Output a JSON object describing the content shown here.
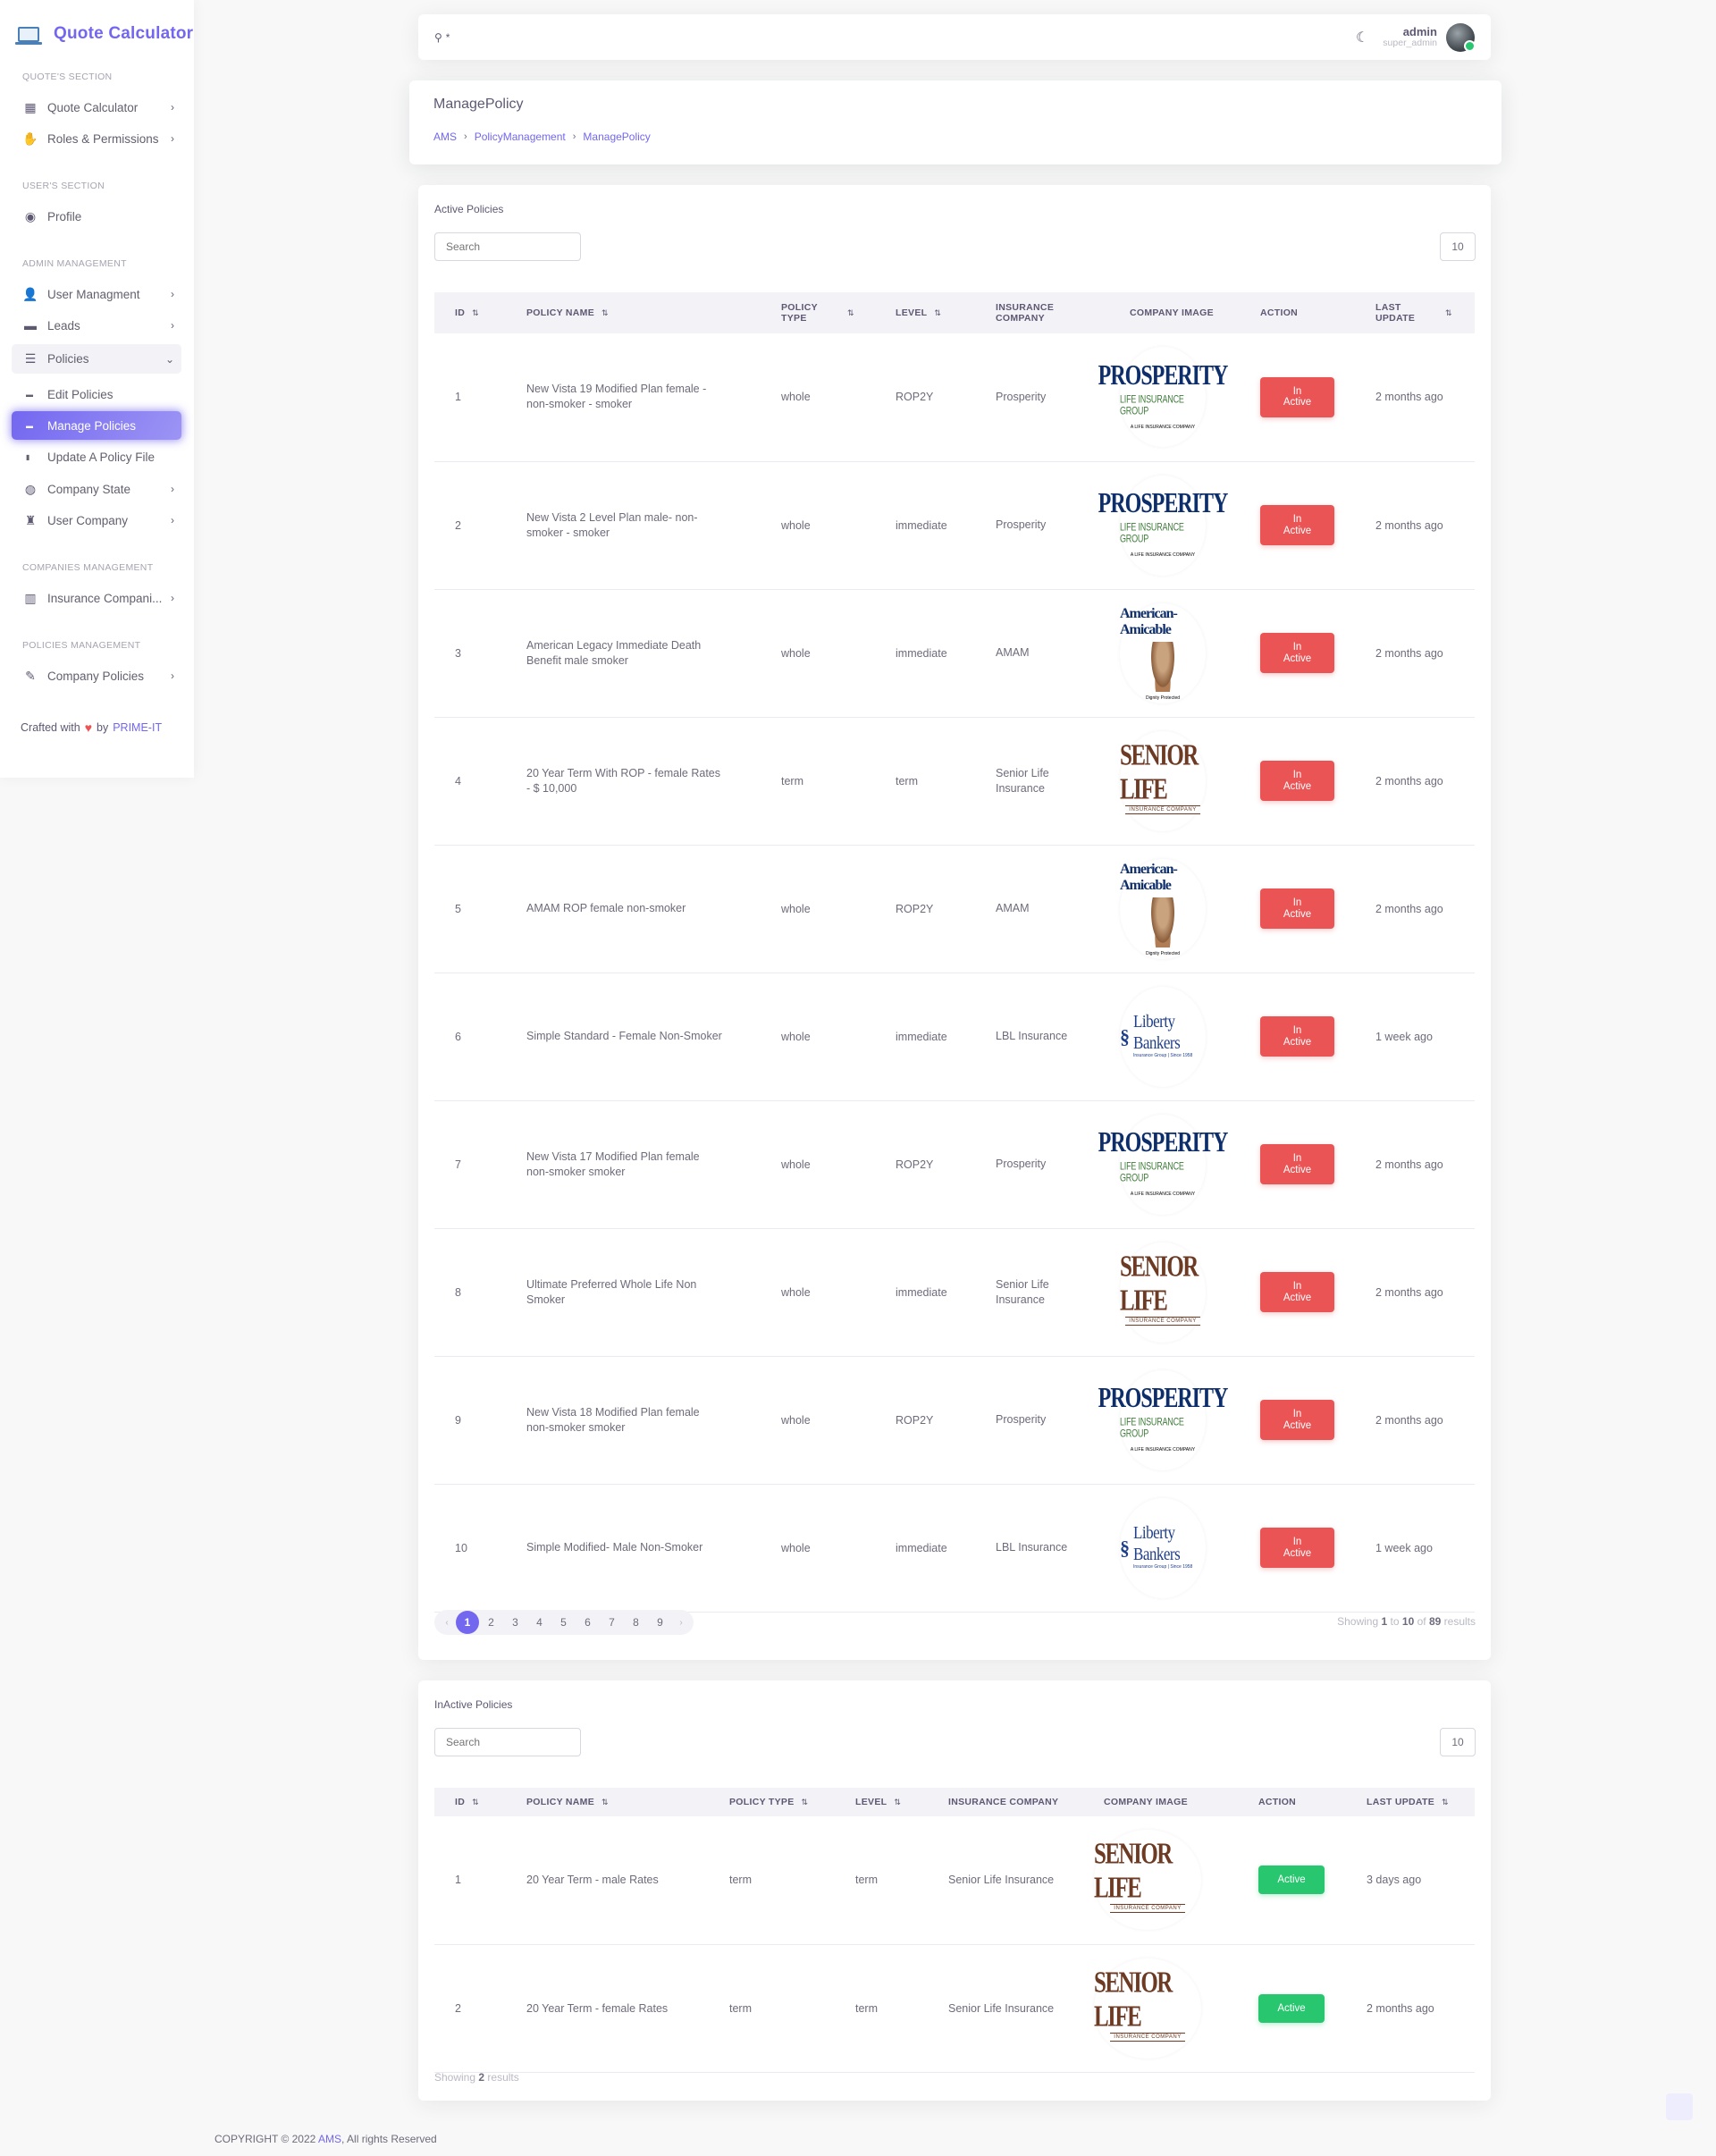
{
  "app": {
    "title": "Quote Calculator"
  },
  "sidebar": {
    "sections": [
      {
        "heading": "QUOTE'S SECTION"
      },
      {
        "heading": "USER'S SECTION"
      },
      {
        "heading": "ADMIN MANAGEMENT"
      },
      {
        "heading": "COMPANIES MANAGEMENT"
      },
      {
        "heading": "POLICIES MANAGEMENT"
      }
    ],
    "items": {
      "quote_calculator": "Quote Calculator",
      "roles": "Roles & Permissions",
      "profile": "Profile",
      "user_management": "User Managment",
      "leads": "Leads",
      "policies": "Policies",
      "edit_policies": "Edit Policies",
      "manage_policies": "Manage Policies",
      "update_policy_file": "Update A Policy File",
      "company_state": "Company State",
      "user_company": "User Company",
      "insurance_companies": "Insurance Compani...",
      "company_policies": "Company Policies"
    },
    "crafted": {
      "prefix": "Crafted with",
      "by": "by",
      "brand": "PRIME-IT"
    }
  },
  "navbar": {
    "search_text": "*",
    "user_name": "admin",
    "user_role": "super_admin"
  },
  "page": {
    "title": "ManagePolicy",
    "breadcrumb": [
      "AMS",
      "PolicyManagement",
      "ManagePolicy"
    ]
  },
  "active_policies": {
    "title": "Active Policies",
    "search_placeholder": "Search",
    "per_page": "10",
    "columns": [
      "ID",
      "POLICY NAME",
      "POLICY TYPE",
      "LEVEL",
      "INSURANCE COMPANY",
      "COMPANY IMAGE",
      "ACTION",
      "LAST UPDATE"
    ],
    "rows": [
      {
        "id": "1",
        "name": "New Vista 19 Modified Plan female - non-smoker - smoker",
        "type": "whole",
        "level": "ROP2Y",
        "company": "Prosperity",
        "logo": "prosperity",
        "action": "In Active",
        "updated": "2 months ago"
      },
      {
        "id": "2",
        "name": "New Vista 2 Level Plan male- non-smoker - smoker",
        "type": "whole",
        "level": "immediate",
        "company": "Prosperity",
        "logo": "prosperity",
        "action": "In Active",
        "updated": "2 months ago"
      },
      {
        "id": "3",
        "name": "American Legacy Immediate Death Benefit male smoker",
        "type": "whole",
        "level": "immediate",
        "company": "AMAM",
        "logo": "amam",
        "action": "In Active",
        "updated": "2 months ago"
      },
      {
        "id": "4",
        "name": "20 Year Term With ROP - female Rates - $ 10,000",
        "type": "term",
        "level": "term",
        "company": "Senior Life Insurance",
        "logo": "senior",
        "action": "In Active",
        "updated": "2 months ago"
      },
      {
        "id": "5",
        "name": "AMAM ROP female non-smoker",
        "type": "whole",
        "level": "ROP2Y",
        "company": "AMAM",
        "logo": "amam",
        "action": "In Active",
        "updated": "2 months ago"
      },
      {
        "id": "6",
        "name": "Simple Standard - Female Non-Smoker",
        "type": "whole",
        "level": "immediate",
        "company": "LBL Insurance",
        "logo": "lbl",
        "action": "In Active",
        "updated": "1 week ago"
      },
      {
        "id": "7",
        "name": "New Vista 17 Modified Plan female non-smoker smoker",
        "type": "whole",
        "level": "ROP2Y",
        "company": "Prosperity",
        "logo": "prosperity",
        "action": "In Active",
        "updated": "2 months ago"
      },
      {
        "id": "8",
        "name": "Ultimate Preferred Whole Life Non Smoker",
        "type": "whole",
        "level": "immediate",
        "company": "Senior Life Insurance",
        "logo": "senior",
        "action": "In Active",
        "updated": "2 months ago"
      },
      {
        "id": "9",
        "name": "New Vista 18 Modified Plan female non-smoker smoker",
        "type": "whole",
        "level": "ROP2Y",
        "company": "Prosperity",
        "logo": "prosperity",
        "action": "In Active",
        "updated": "2 months ago"
      },
      {
        "id": "10",
        "name": "Simple Modified- Male Non-Smoker",
        "type": "whole",
        "level": "immediate",
        "company": "LBL Insurance",
        "logo": "lbl",
        "action": "In Active",
        "updated": "1 week ago"
      }
    ],
    "pagination": {
      "prev": "‹",
      "next": "›",
      "pages": [
        "1",
        "2",
        "3",
        "4",
        "5",
        "6",
        "7",
        "8",
        "9"
      ],
      "current": "1"
    },
    "showing": {
      "prefix": "Showing",
      "from": "1",
      "to_word": "to",
      "to": "10",
      "of_word": "of",
      "total": "89",
      "suffix": "results"
    }
  },
  "inactive_policies": {
    "title": "InActive Policies",
    "search_placeholder": "Search",
    "per_page": "10",
    "columns": [
      "ID",
      "POLICY NAME",
      "POLICY TYPE",
      "LEVEL",
      "INSURANCE COMPANY",
      "COMPANY IMAGE",
      "ACTION",
      "LAST UPDATE"
    ],
    "rows": [
      {
        "id": "1",
        "name": "20 Year Term - male Rates",
        "type": "term",
        "level": "term",
        "company": "Senior Life Insurance",
        "logo": "senior",
        "action": "Active",
        "updated": "3 days ago"
      },
      {
        "id": "2",
        "name": "20 Year Term - female Rates",
        "type": "term",
        "level": "term",
        "company": "Senior Life Insurance",
        "logo": "senior",
        "action": "Active",
        "updated": "2 months ago"
      }
    ],
    "showing": {
      "prefix": "Showing",
      "total": "2",
      "suffix": "results"
    }
  },
  "logos": {
    "prosperity": {
      "line1": "PROSPERITY",
      "line2": "LIFE INSURANCE GROUP",
      "line3": "A LIFE INSURANCE COMPANY"
    },
    "senior": {
      "line1": "SENIOR LIFE",
      "line2": "INSURANCE COMPANY"
    },
    "amam": {
      "line1": "American-Amicable",
      "line3": "Dignity Protected"
    },
    "lbl": {
      "mark": "§",
      "line1": "Liberty Bankers",
      "line2": "Insurance Group | Since 1958"
    }
  },
  "footer": {
    "prefix": "COPYRIGHT © 2022",
    "brand": "AMS",
    "suffix": ", All rights Reserved"
  },
  "colors": {
    "primary": "#7367f0",
    "danger": "#ea5455",
    "success": "#28c76f"
  }
}
